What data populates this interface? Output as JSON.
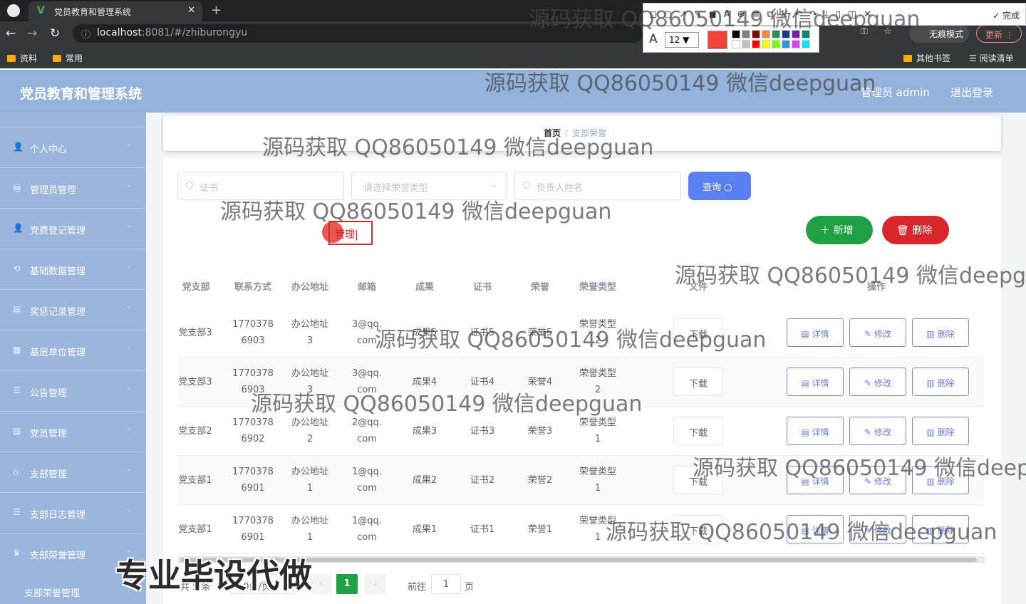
{
  "browser": {
    "tab_title": "党员教育和管理系统",
    "tab_favicon": "V",
    "tab_close": "✕",
    "new_tab": "+",
    "url_host": "localhost",
    "url_path": ":8081/#/zhiburongyu",
    "incognito_label": "无痕模式",
    "update_label": "更新",
    "done_label": "完成",
    "bookmarks": [
      "资料",
      "常用"
    ],
    "bookmarks_right": [
      "其他书签",
      "阅读清单"
    ],
    "font_size": "12",
    "font_size_caret": "▼",
    "swatch_colors": [
      "#000000",
      "#808080",
      "#800000",
      "#f28b40",
      "#2e8b57",
      "#1e3a8a",
      "#7b1fa2",
      "#00897b",
      "#ffffff",
      "#c0c0c0",
      "#ff0000",
      "#ffff00",
      "#76ff03",
      "#2196f3",
      "#e040fb",
      "#00e5ff"
    ],
    "current_color": "#f44336"
  },
  "header": {
    "title": "党员教育和管理系统",
    "admin": "管理员 admin",
    "logout": "退出登录"
  },
  "sidebar": {
    "items": [
      {
        "icon": "user-icon",
        "label": "个人中心"
      },
      {
        "icon": "list-icon",
        "label": "管理员管理"
      },
      {
        "icon": "user-icon",
        "label": "党费登记管理"
      },
      {
        "icon": "database-icon",
        "label": "基础数据管理"
      },
      {
        "icon": "list-icon",
        "label": "奖惩记录管理"
      },
      {
        "icon": "building-icon",
        "label": "基层单位管理"
      },
      {
        "icon": "menu-icon",
        "label": "公告管理"
      },
      {
        "icon": "list-icon",
        "label": "党员管理"
      },
      {
        "icon": "home-icon",
        "label": "支部管理"
      },
      {
        "icon": "menu-icon",
        "label": "支部日志管理"
      },
      {
        "icon": "trophy-icon",
        "label": "支部荣誉管理"
      }
    ],
    "sub_item": "支部荣誉管理"
  },
  "breadcrumb": {
    "home": "首页",
    "separator": "/",
    "current": "支部荣誉"
  },
  "search": {
    "cert_placeholder": "证书",
    "type_placeholder": "请选择荣誉类型",
    "person_placeholder": "负责人姓名",
    "query_label": "查询"
  },
  "actions": {
    "add_label": "新增",
    "delete_label": "删除"
  },
  "annotation_text": "管理",
  "table": {
    "headers": [
      "党支部",
      "联系方式",
      "办公地址",
      "邮箱",
      "成果",
      "证书",
      "荣誉",
      "荣誉类型",
      "文件",
      "操作"
    ],
    "download_label": "下载",
    "detail_label": "详情",
    "edit_label": "修改",
    "row_delete_label": "删除",
    "rows": [
      {
        "branch": "党支部3",
        "phone": "17703786903",
        "address": "办公地址3",
        "email": "3@qq.com",
        "result": "成果5",
        "cert": "证书5",
        "honor": "荣誉5",
        "type": "荣誉类型2"
      },
      {
        "branch": "党支部3",
        "phone": "17703786903",
        "address": "办公地址3",
        "email": "3@qq.com",
        "result": "成果4",
        "cert": "证书4",
        "honor": "荣誉4",
        "type": "荣誉类型2"
      },
      {
        "branch": "党支部2",
        "phone": "17703786902",
        "address": "办公地址2",
        "email": "2@qq.com",
        "result": "成果3",
        "cert": "证书3",
        "honor": "荣誉3",
        "type": "荣誉类型1"
      },
      {
        "branch": "党支部1",
        "phone": "17703786901",
        "address": "办公地址1",
        "email": "1@qq.com",
        "result": "成果2",
        "cert": "证书2",
        "honor": "荣誉2",
        "type": "荣誉类型1"
      },
      {
        "branch": "党支部1",
        "phone": "17703786901",
        "address": "办公地址1",
        "email": "1@qq.com",
        "result": "成果1",
        "cert": "证书1",
        "honor": "荣誉1",
        "type": "荣誉类型1"
      }
    ]
  },
  "pagination": {
    "total": "共 5 条",
    "page_size": "10条/页",
    "current_page": "1",
    "goto_label": "前往",
    "goto_value": "1",
    "unit": "页"
  },
  "watermark_text": "源码获取 QQ86050149 微信deepguan",
  "promo_text": "专业毕设代做"
}
